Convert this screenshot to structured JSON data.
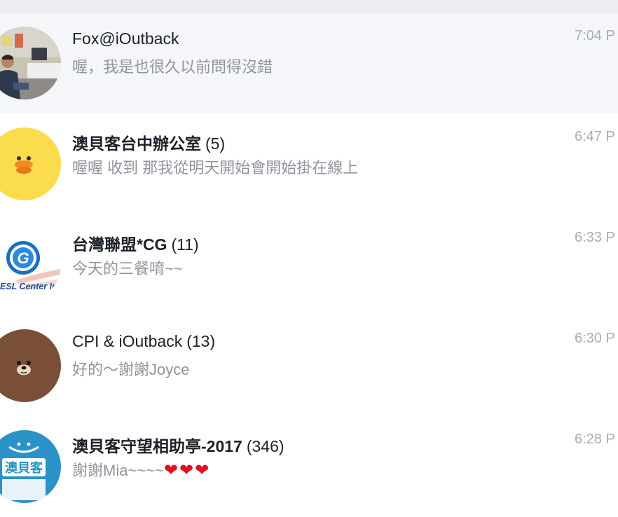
{
  "conversations": [
    {
      "name": "Fox@iOutback",
      "count": "",
      "preview": "喔，我是也很久以前問得沒錯",
      "time": "7:04 P",
      "bold": false,
      "selected": true,
      "avatar": "person-photo-avatar"
    },
    {
      "name": "澳貝客台中辦公室",
      "count": "(5)",
      "preview": "喔喔  收到  那我從明天開始會開始掛在線上",
      "time": "6:47 P",
      "bold": true,
      "selected": false,
      "avatar": "yellow-duck-avatar"
    },
    {
      "name": "台灣聯盟*CG",
      "count": "(11)",
      "preview": "今天的三餐唷~~",
      "time": "6:33 P",
      "bold": true,
      "selected": false,
      "avatar": "esl-center-logo-avatar",
      "avatar_text": "ESL Center In"
    },
    {
      "name": "CPI & iOutback",
      "count": "(13)",
      "preview": "好的～謝謝Joyce",
      "time": "6:30 P",
      "bold": false,
      "selected": false,
      "avatar": "brown-bear-avatar"
    },
    {
      "name": "澳貝客守望相助亭-2017",
      "count": "(346)",
      "preview": "謝謝Mia~~~~",
      "preview_hearts": "❤❤❤",
      "time": "6:28 P",
      "bold": true,
      "selected": false,
      "avatar": "iOutback-logo-avatar",
      "avatar_text": "澳貝客"
    }
  ],
  "colors": {
    "selected_row": "#f4f6f9",
    "title_text": "#1d2129",
    "preview_text": "#90949c",
    "time_text": "#a8adb5",
    "heart": "#e0121f"
  }
}
